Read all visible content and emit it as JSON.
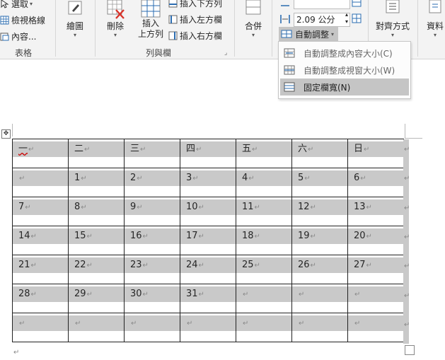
{
  "ribbon": {
    "select_label": "選取",
    "view_gridlines_label": "檢視格線",
    "properties_label": "內容...",
    "group_table": "表格",
    "draw_label": "繪圖",
    "delete_label": "刪除",
    "insert_above_line1": "插入",
    "insert_above_line2": "上方列",
    "insert_below_label": "插入下方列",
    "insert_left_label": "插入左方欄",
    "insert_right_label": "插入右方欄",
    "group_rows_cols": "列與欄",
    "merge_label": "合併",
    "width_value": "2.09 公分",
    "autofit_label": "自動調整",
    "align_label": "對齊方式",
    "data_label": "資料"
  },
  "autofit_menu": {
    "items": [
      {
        "label": "自動調整成內容大小(C)"
      },
      {
        "label": "自動調整成視窗大小(W)"
      },
      {
        "label": "固定欄寬(N)"
      }
    ],
    "selected_index": 2
  },
  "calendar": {
    "header": [
      "一",
      "二",
      "三",
      "四",
      "五",
      "六",
      "日"
    ],
    "rows": [
      [
        "",
        "1",
        "2",
        "3",
        "4",
        "5",
        "6"
      ],
      [
        "7",
        "8",
        "9",
        "10",
        "11",
        "12",
        "13"
      ],
      [
        "14",
        "15",
        "16",
        "17",
        "18",
        "19",
        "20"
      ],
      [
        "21",
        "22",
        "23",
        "24",
        "25",
        "26",
        "27"
      ],
      [
        "28",
        "29",
        "30",
        "31",
        "",
        "",
        ""
      ],
      [
        "",
        "",
        "",
        "",
        "",
        "",
        ""
      ]
    ],
    "paragraph_mark": "↵"
  },
  "colors": {
    "ribbon_bg": "#f3f3f3",
    "cell_shading": "#c9c9c9",
    "menu_selected": "#c5c5c5",
    "table_border": "#222222"
  }
}
